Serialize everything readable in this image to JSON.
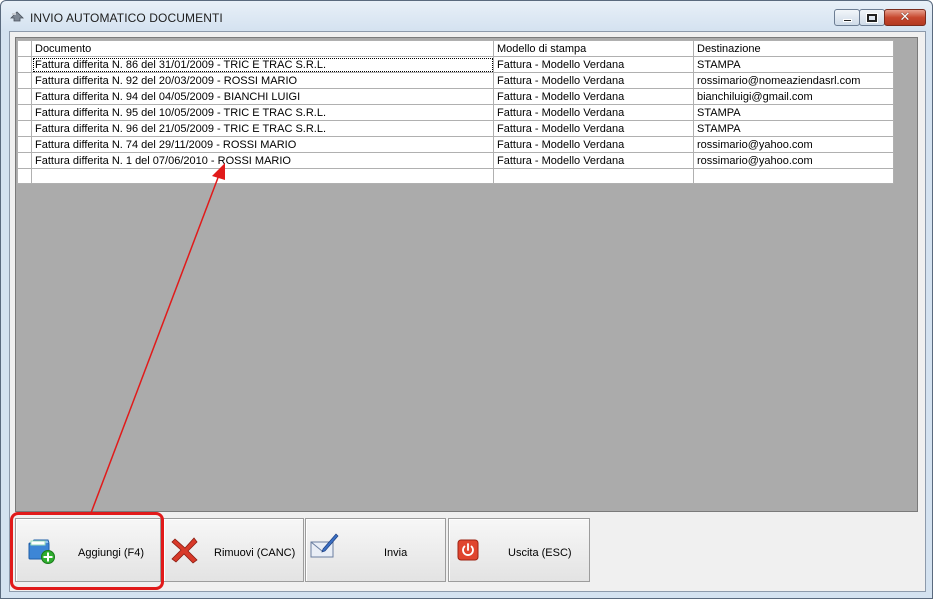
{
  "window": {
    "title": "INVIO AUTOMATICO DOCUMENTI",
    "controls": {
      "minimize": "–",
      "maximize": "□",
      "close": "✕"
    }
  },
  "table": {
    "columns": [
      "Documento",
      "Modello di stampa",
      "Destinazione"
    ],
    "rows": [
      [
        "Fattura differita N. 86 del 31/01/2009 - TRIC E TRAC S.R.L.",
        "Fattura - Modello Verdana",
        "STAMPA"
      ],
      [
        "Fattura differita N. 92 del 20/03/2009 - ROSSI MARIO",
        "Fattura - Modello Verdana",
        "rossimario@nomeaziendasrl.com"
      ],
      [
        "Fattura differita N. 94 del 04/05/2009 - BIANCHI LUIGI",
        "Fattura - Modello Verdana",
        "bianchiluigi@gmail.com"
      ],
      [
        "Fattura differita N. 95 del 10/05/2009 - TRIC E TRAC S.R.L.",
        "Fattura - Modello Verdana",
        "STAMPA"
      ],
      [
        "Fattura differita N. 96 del 21/05/2009 - TRIC E TRAC S.R.L.",
        "Fattura - Modello Verdana",
        "STAMPA"
      ],
      [
        "Fattura differita N. 74 del 29/11/2009 - ROSSI MARIO",
        "Fattura - Modello Verdana",
        "rossimario@yahoo.com"
      ],
      [
        "Fattura differita N. 1 del 07/06/2010 - ROSSI MARIO",
        "Fattura - Modello Verdana",
        "rossimario@yahoo.com"
      ]
    ]
  },
  "buttons": {
    "add": {
      "label": "Aggiungi (F4)",
      "icon": "folder-add-icon"
    },
    "remove": {
      "label": "Rimuovi (CANC)",
      "icon": "red-x-icon"
    },
    "send": {
      "label": "Invia",
      "icon": "envelope-pen-icon"
    },
    "exit": {
      "label": "Uscita (ESC)",
      "icon": "power-icon"
    }
  },
  "annotation": {
    "color": "#e11a1a"
  }
}
